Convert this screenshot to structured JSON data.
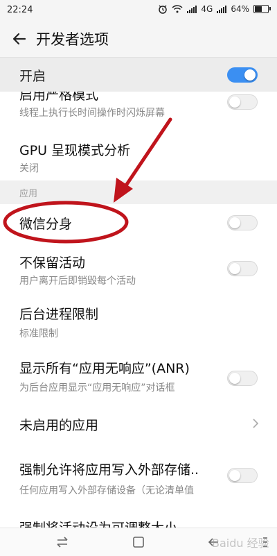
{
  "status_bar": {
    "time": "22:24",
    "network": "4G",
    "battery": "64%",
    "battery_level": 0.64
  },
  "header": {
    "title": "开发者选项"
  },
  "master": {
    "label": "开启",
    "enabled": true
  },
  "rows": [
    {
      "title": "启用严格模式",
      "subtitle": "线程上执行长时间操作时闪烁屏幕",
      "toggle": false
    },
    {
      "title": "GPU 呈现模式分析",
      "subtitle": "关闭"
    },
    {
      "section": "应用"
    },
    {
      "title": "微信分身",
      "toggle": false
    },
    {
      "title": "不保留活动",
      "subtitle": "用户离开后即销毁每个活动",
      "toggle": false
    },
    {
      "title": "后台进程限制",
      "subtitle": "标准限制"
    },
    {
      "title": "显示所有“应用无响应”(ANR)",
      "subtitle": "为后台应用显示“应用无响应”对话框",
      "toggle": false
    },
    {
      "title": "未启用的应用",
      "chevron": true
    },
    {
      "title": "强制允许将应用写入外部存储..",
      "subtitle": "任何应用写入外部存储设备（无论清单值",
      "toggle": false
    },
    {
      "title": "强制将活动设为可调整大小"
    }
  ],
  "watermark": "Baidu 经验",
  "annotation_color": "#c0141c",
  "accent_color": "#3b8ff2"
}
